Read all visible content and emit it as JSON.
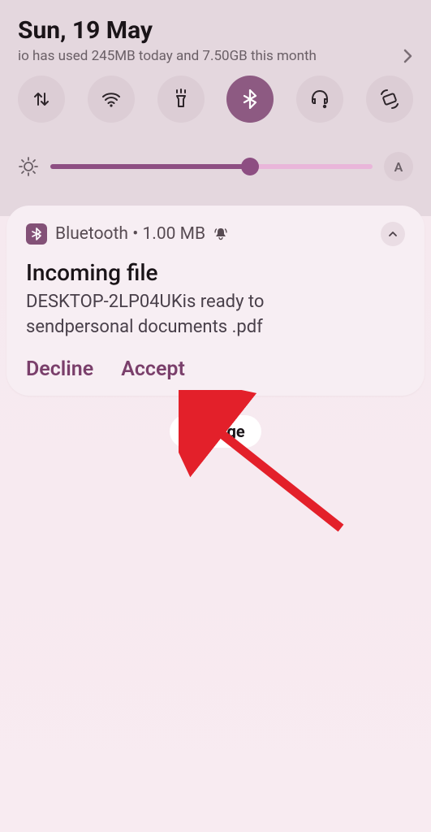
{
  "header": {
    "date": "Sun, 19 May",
    "usage_text": "io has used 245MB today and 7.50GB this month"
  },
  "tiles": {
    "data": {
      "name": "data-icon"
    },
    "wifi": {
      "name": "wifi-icon"
    },
    "flashlight": {
      "name": "flashlight-icon"
    },
    "bluetooth": {
      "name": "bluetooth-icon",
      "active": true
    },
    "sound": {
      "name": "sound-icon"
    },
    "rotate": {
      "name": "rotate-icon"
    }
  },
  "brightness": {
    "value_percent": 62,
    "auto_label": "A"
  },
  "notification": {
    "app": "Bluetooth",
    "size": "1.00 MB",
    "separator": "•",
    "title": "Incoming file",
    "body_line1": "DESKTOP-2LP04UKis ready to",
    "body_line2": "sendpersonal documents .pdf",
    "decline_label": "Decline",
    "accept_label": "Accept"
  },
  "manage_label": "Manage"
}
